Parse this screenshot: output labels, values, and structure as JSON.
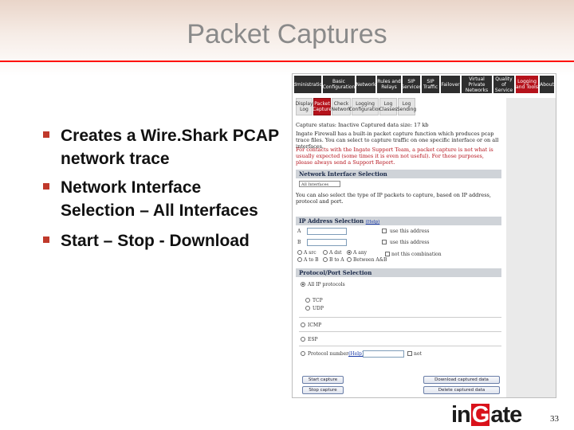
{
  "slide": {
    "title": "Packet Captures",
    "bullets": [
      "Creates a Wire.Shark PCAP network trace",
      "Network Interface Selection – All Interfaces",
      "Start – Stop - Download"
    ],
    "page_number": "33",
    "logo": {
      "prefix": "in",
      "box_letter": "G",
      "suffix": "ate"
    },
    "accent_color": "#ff1100"
  },
  "screenshot": {
    "top_nav": [
      "Administration",
      "Basic Configuration",
      "Network",
      "Rules and Relays",
      "SIP Services",
      "SIP Traffic",
      "Failover",
      "Virtual Private Networks",
      "Quality of Service",
      "Logging and Tools",
      "About"
    ],
    "top_nav_active": "Logging and Tools",
    "sub_tabs": [
      "Display Log",
      "Packet Capture",
      "Check Network",
      "Logging Configuration",
      "Log Classes",
      "Log Sending"
    ],
    "sub_tab_active": "Packet Capture",
    "status_line": "Capture status: Inactive   Captured data size: 17 kb",
    "intro": "Ingate Firewall has a built-in packet capture function which produces pcap trace files. You can select to capture traffic on one specific interface or on all interfaces.",
    "warning": "For contacts with the Ingate Support Team, a packet capture is not what is usually expected (some times it is even not useful). For those purposes, please always send a Support Report.",
    "warning_link": "Support Report",
    "network_interface_header": "Network Interface Selection",
    "interface_select": "All Interfaces",
    "filter_text": "You can also select the type of IP packets to capture, based on IP address, protocol and port.",
    "ip_header": "IP Address Selection",
    "ip_help": "(Help)",
    "ip_rows": [
      {
        "label": "A",
        "check_label": "use this address"
      },
      {
        "label": "B",
        "check_label": "use this address"
      }
    ],
    "direction_options": [
      "A src",
      "A dst",
      "A any",
      "A to B",
      "B to A",
      "Between A&B"
    ],
    "direction_selected": "A any",
    "not_this_combination": "not this combination",
    "protocol_header": "Protocol/Port Selection",
    "protocol_options": [
      "All IP protocols",
      "TCP",
      "UDP",
      "ICMP",
      "ESP",
      "Protocol number:"
    ],
    "protocol_selected": "All IP protocols",
    "protocol_help": "(Help)",
    "protocol_not": "not",
    "buttons": {
      "start": "Start capture",
      "stop": "Stop capture",
      "download": "Download captured data",
      "delete": "Delete captured data"
    }
  }
}
